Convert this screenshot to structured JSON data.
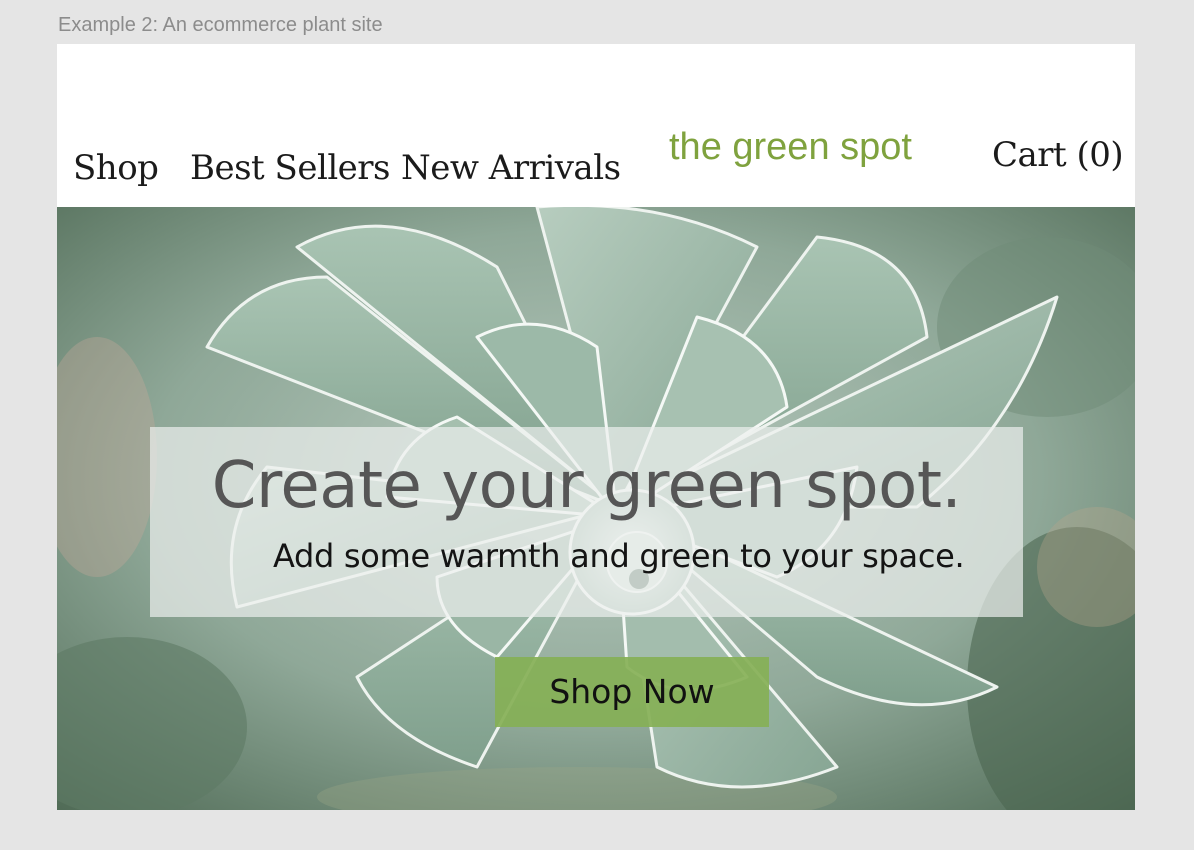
{
  "frame": {
    "label": "Example 2: An ecommerce plant site"
  },
  "nav": {
    "items": [
      {
        "label": "Shop"
      },
      {
        "label": "Best Sellers"
      },
      {
        "label": "New Arrivals"
      }
    ],
    "brand": "the green spot",
    "cart_label": "Cart (0)"
  },
  "hero": {
    "headline": "Create your green spot.",
    "subheadline": "Add some warmth and green to your space.",
    "cta_label": "Shop Now",
    "image": "succulent-photo"
  },
  "colors": {
    "canvas_bg": "#e5e5e5",
    "brand_green": "#7fa23e",
    "cta_green": "#86b056",
    "headline_gray": "#565656",
    "nav_text": "#1b1b1b"
  }
}
